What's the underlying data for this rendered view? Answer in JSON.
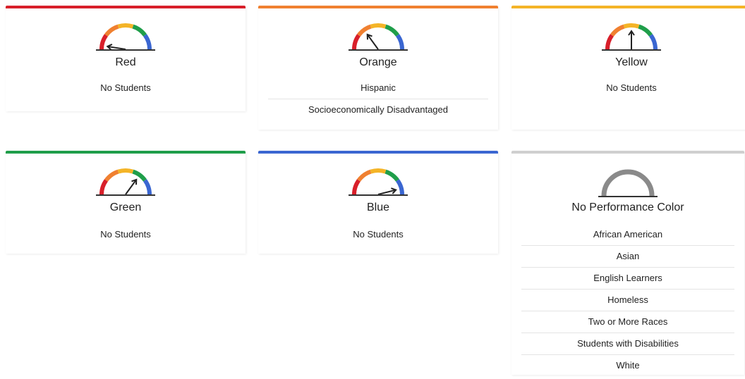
{
  "colors": {
    "red": "#d81f2a",
    "orange": "#f08030",
    "yellow": "#f4b427",
    "green": "#1f9e4a",
    "blue": "#3a66d1",
    "gray": "#cfcfcf",
    "gauge_gray": "#8a8a8a"
  },
  "cards": [
    {
      "key": "red",
      "title": "Red",
      "needle_level": 0.05,
      "items": [
        "No Students"
      ]
    },
    {
      "key": "orange",
      "title": "Orange",
      "needle_level": 0.3,
      "items": [
        "Hispanic",
        "Socioeconomically Disadvantaged"
      ]
    },
    {
      "key": "yellow",
      "title": "Yellow",
      "needle_level": 0.5,
      "items": [
        "No Students"
      ]
    },
    {
      "key": "green",
      "title": "Green",
      "needle_level": 0.7,
      "items": [
        "No Students"
      ]
    },
    {
      "key": "blue",
      "title": "Blue",
      "needle_level": 0.92,
      "items": [
        "No Students"
      ]
    },
    {
      "key": "none",
      "title": "No Performance Color",
      "needle_level": null,
      "items": [
        "African American",
        "Asian",
        "English Learners",
        "Homeless",
        "Two or More Races",
        "Students with Disabilities",
        "White"
      ]
    }
  ]
}
